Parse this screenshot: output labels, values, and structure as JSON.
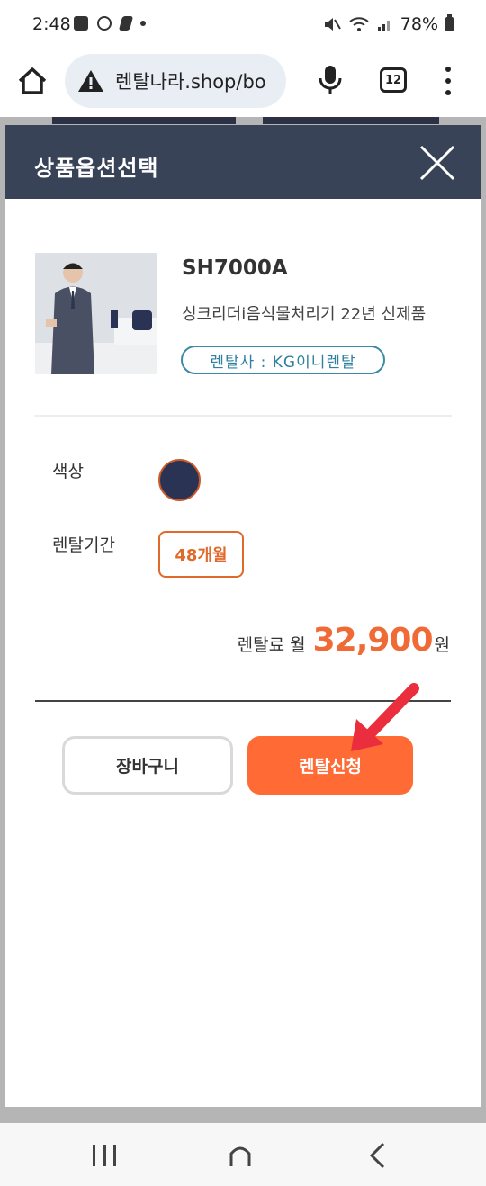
{
  "status_bar": {
    "time": "2:48",
    "battery": "78%",
    "icons": [
      "image-icon",
      "b-app-icon",
      "pen-icon",
      "dot-icon",
      "mute-icon",
      "wifi-icon",
      "signal-icon",
      "battery-icon"
    ]
  },
  "browser": {
    "url": "렌탈나라.shop/bo",
    "tab_count": "12"
  },
  "modal": {
    "title": "상품옵션선택",
    "product": {
      "name": "SH7000A",
      "description": "싱크리더i음식물처리기 22년 신제품",
      "vendor": "렌탈사 : KG이니렌탈"
    },
    "options": {
      "color_label": "색상",
      "color_value": "#2b3354",
      "period_label": "렌탈기간",
      "period_value": "48개월"
    },
    "price": {
      "label": "렌탈료 월",
      "amount": "32,900",
      "unit": "원"
    },
    "buttons": {
      "cart": "장바구니",
      "apply": "렌탈신청"
    }
  },
  "colors": {
    "header_bg": "#384358",
    "accent": "#ff6a35",
    "vendor_badge": "#3b8aa6"
  }
}
